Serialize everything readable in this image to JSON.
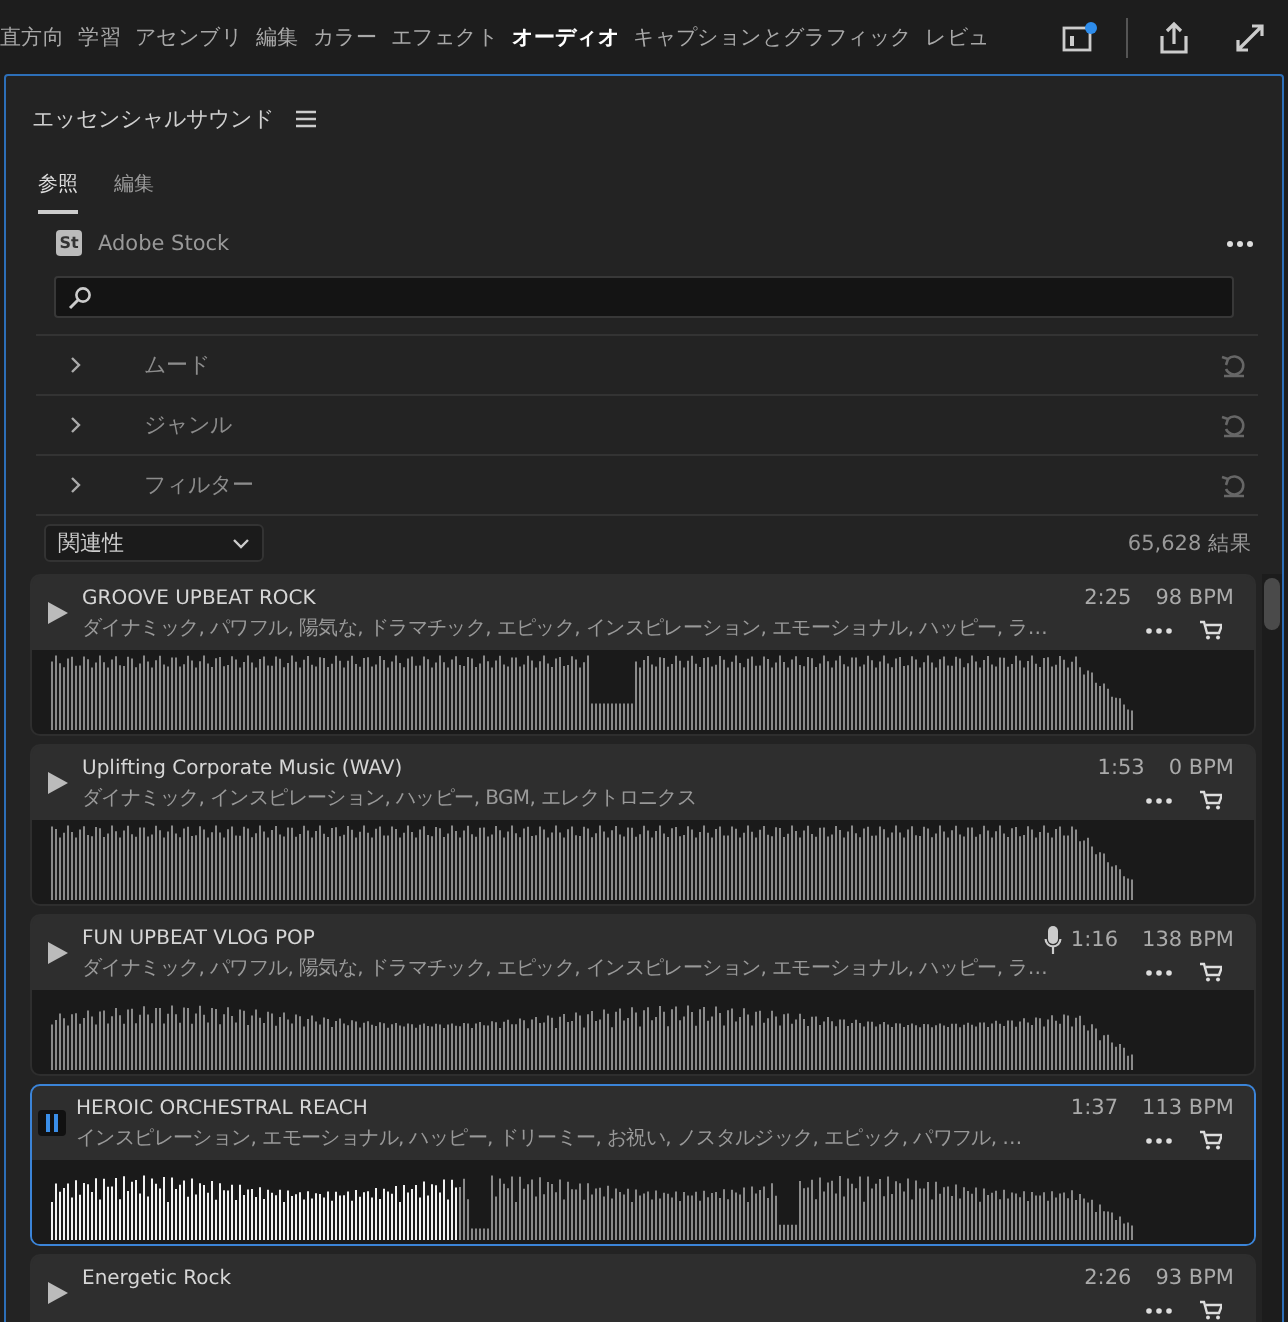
{
  "workspaces": [
    {
      "label": "直方向",
      "selected": false
    },
    {
      "label": "学習",
      "selected": false
    },
    {
      "label": "アセンブリ",
      "selected": false
    },
    {
      "label": "編集",
      "selected": false
    },
    {
      "label": "カラー",
      "selected": false
    },
    {
      "label": "エフェクト",
      "selected": false
    },
    {
      "label": "オーディオ",
      "selected": true
    },
    {
      "label": "キャプションとグラフィック",
      "selected": false
    },
    {
      "label": "レビュ",
      "selected": false
    }
  ],
  "panel": {
    "title": "エッセンシャルサウンド",
    "tabs": [
      {
        "label": "参照",
        "selected": true
      },
      {
        "label": "編集",
        "selected": false
      }
    ],
    "source_badge": "St",
    "source": "Adobe Stock",
    "filters": [
      {
        "label": "ムード",
        "expanded": false
      },
      {
        "label": "ジャンル",
        "expanded": false
      },
      {
        "label": "フィルター",
        "expanded": false
      }
    ],
    "sort": "関連性",
    "results": "65,628 結果",
    "tracks": [
      {
        "title": "GROOVE UPBEAT ROCK",
        "tags": "ダイナミック, パワフル, 陽気な, ドラマチック, エピック, インスピレーション, エモーショナル, ハッピー, ラ…",
        "duration": "2:25",
        "bpm": "98 BPM",
        "vocals": false,
        "playing": false,
        "selected": false
      },
      {
        "title": "Uplifting Corporate Music (WAV)",
        "tags": "ダイナミック, インスピレーション, ハッピー, BGM, エレクトロニクス",
        "duration": "1:53",
        "bpm": "0 BPM",
        "vocals": false,
        "playing": false,
        "selected": false
      },
      {
        "title": "FUN UPBEAT VLOG POP",
        "tags": "ダイナミック, パワフル, 陽気な, ドラマチック, エピック, インスピレーション, エモーショナル, ハッピー, ラ…",
        "duration": "1:16",
        "bpm": "138 BPM",
        "vocals": true,
        "playing": false,
        "selected": false
      },
      {
        "title": "HEROIC ORCHESTRAL REACH",
        "tags": "インスピレーション, エモーショナル, ハッピー, ドリーミー, お祝い, ノスタルジック, エピック, パワフル, …",
        "duration": "1:37",
        "bpm": "113 BPM",
        "vocals": false,
        "playing": true,
        "selected": true,
        "level": 0.37
      },
      {
        "title": "Energetic Rock",
        "duration": "2:26",
        "bpm": "93 BPM",
        "vocals": false,
        "playing": false,
        "selected": false
      }
    ]
  }
}
